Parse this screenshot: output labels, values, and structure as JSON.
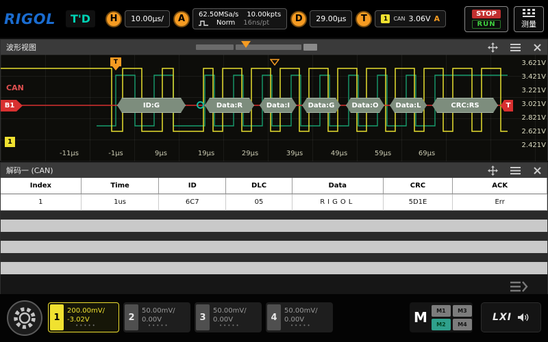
{
  "header": {
    "logo": "RIGOL",
    "trig_status": "T'D",
    "h_label": "H",
    "h_value": "10.00μs/",
    "a_label": "A",
    "sample_rate": "62.50MSa/s",
    "mem_depth": "10.00kpts",
    "acq_mode": "Norm",
    "sample_interval": "16ns/pt",
    "d_label": "D",
    "d_value": "29.00μs",
    "t_label": "T",
    "t_source": "1",
    "t_bus": "CAN",
    "t_level": "3.06V",
    "t_slope": "A",
    "stop": "STOP",
    "run": "RUN",
    "measure": "测量"
  },
  "wave": {
    "title": "波形视图",
    "bus_name": "CAN",
    "bus_tag": "B1",
    "trig_marker": "T",
    "right_marker": "T",
    "ch_marker": "1",
    "blocks": [
      "ID:G",
      "Data:R",
      "Data:I",
      "Data:G",
      "Data:O",
      "Data:L",
      "CRC:RS"
    ],
    "volts": [
      "3.621V",
      "3.421V",
      "3.221V",
      "3.021V",
      "2.821V",
      "2.621V",
      "2.421V"
    ],
    "times": [
      "-11μs",
      "-1μs",
      "9μs",
      "19μs",
      "29μs",
      "39μs",
      "49μs",
      "59μs",
      "69μs"
    ]
  },
  "decode": {
    "title": "解码一 (CAN)",
    "columns": [
      "Index",
      "Time",
      "ID",
      "DLC",
      "Data",
      "CRC",
      "ACK"
    ],
    "row": {
      "index": "1",
      "time": "1us",
      "id": "6C7",
      "dlc": "05",
      "data": "RIGOL",
      "crc": "5D1E",
      "ack": "Err"
    }
  },
  "footer": {
    "channels": [
      {
        "num": "1",
        "scale": "200.00mV/",
        "offset": "-3.02V"
      },
      {
        "num": "2",
        "scale": "50.00mV/",
        "offset": "0.00V"
      },
      {
        "num": "3",
        "scale": "50.00mV/",
        "offset": "0.00V"
      },
      {
        "num": "4",
        "scale": "50.00mV/",
        "offset": "0.00V"
      }
    ],
    "m_label": "M",
    "m_buttons": [
      "M1",
      "M3",
      "M2",
      "M4"
    ],
    "lxi": "LXI"
  },
  "colors": {
    "accent": "#f59b22",
    "ch1": "#f0e130",
    "teal": "#00d2b4",
    "red": "#d83030",
    "run_green": "#3ecf3e"
  }
}
